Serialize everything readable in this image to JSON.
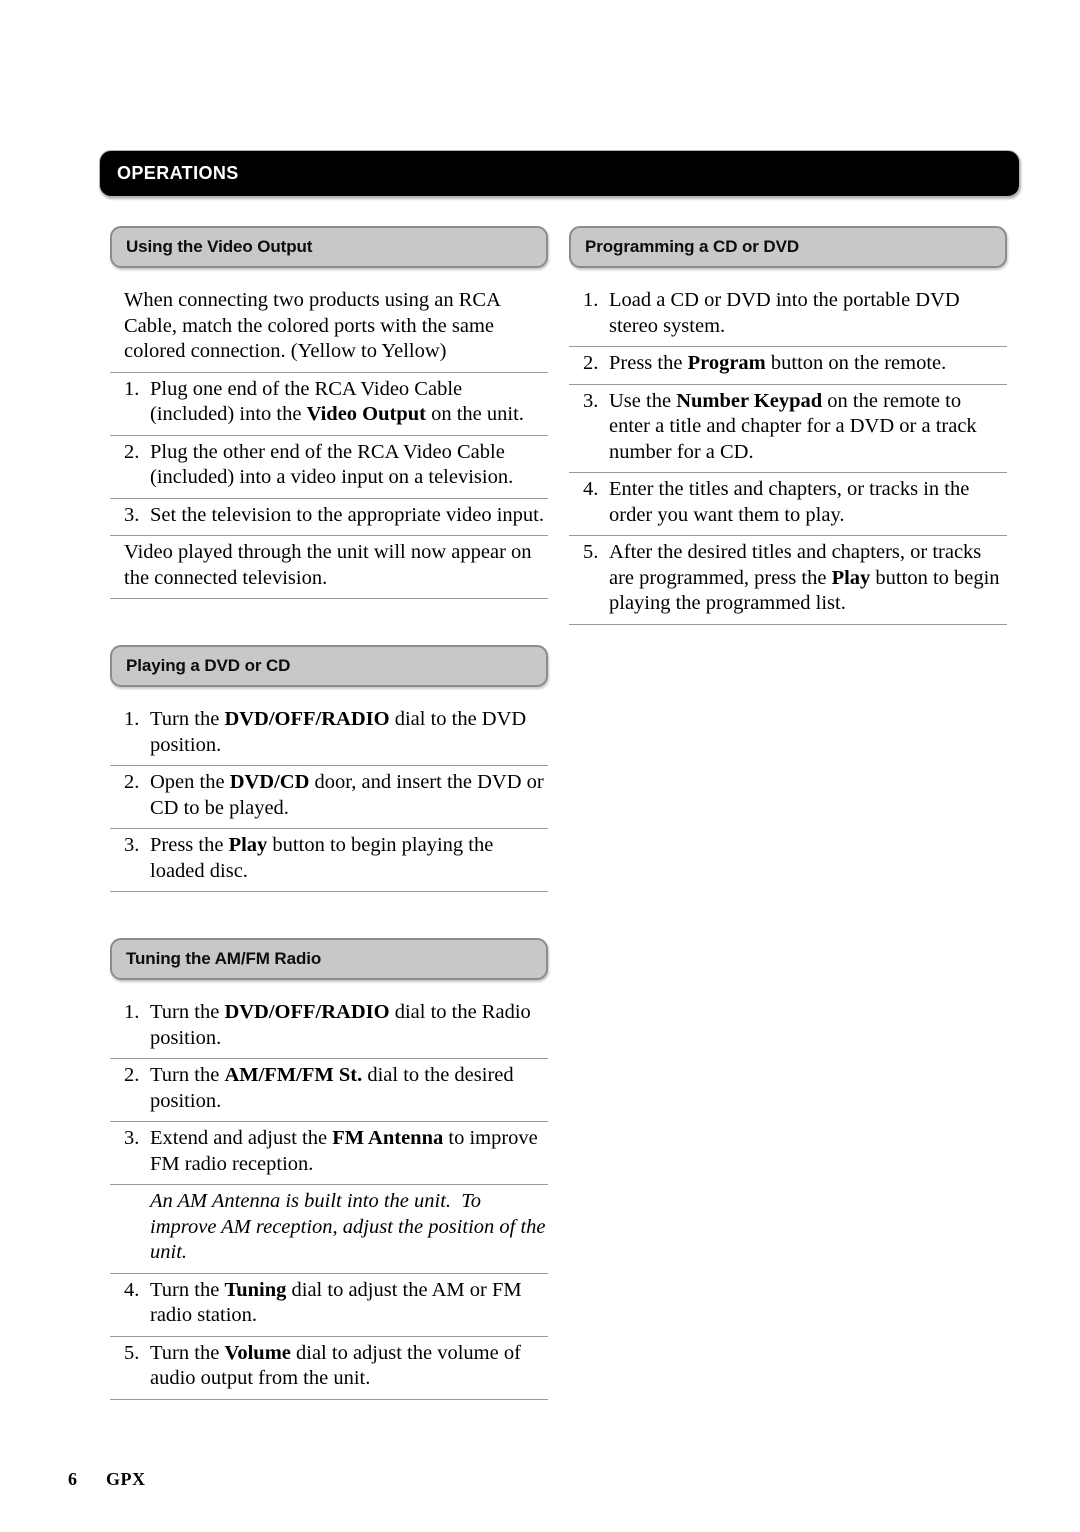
{
  "page": {
    "banner_title": "OPERATIONS",
    "background_color": "#ffffff",
    "banner_color": "#000000",
    "section_header_fill": "#c8c8c8",
    "section_header_border": "#8c8c8c",
    "rule_color": "#9a9a9a"
  },
  "footer": {
    "page_number": "6",
    "brand": "GPX"
  },
  "left_column": {
    "sections": [
      {
        "title": "Using the Video Output",
        "blocks": [
          {
            "kind": "paragraph",
            "html": "When connecting two products using an RCA Cable, match the colored ports with the same colored connection. (Yellow to Yellow)"
          },
          {
            "kind": "step",
            "num": "1.",
            "html": "Plug one end of the RCA Video Cable (included) into the <b>Video Output</b> on the unit."
          },
          {
            "kind": "step",
            "num": "2.",
            "html": "Plug the other end of the RCA Video Cable (included) into a video input on a television."
          },
          {
            "kind": "step",
            "num": "3.",
            "html": "Set the television to the appropriate video input."
          },
          {
            "kind": "paragraph",
            "html": "Video played through the unit will now appear on the connected television."
          }
        ]
      },
      {
        "title": "Playing a DVD or CD",
        "blocks": [
          {
            "kind": "step",
            "num": "1.",
            "html": "Turn the <b>DVD/OFF/RADIO</b> dial to the DVD position."
          },
          {
            "kind": "step",
            "num": "2.",
            "html": "Open the <b>DVD/CD</b> door, and insert the DVD or CD to be played."
          },
          {
            "kind": "step",
            "num": "3.",
            "html": "Press the <b>Play</b> button to begin playing the loaded disc."
          }
        ]
      },
      {
        "title": "Tuning the AM/FM Radio",
        "blocks": [
          {
            "kind": "step",
            "num": "1.",
            "html": "Turn the <b>DVD/OFF/RADIO</b> dial to the Radio position."
          },
          {
            "kind": "step",
            "num": "2.",
            "html": "Turn the <b>AM/FM/FM St.</b> dial to the desired position."
          },
          {
            "kind": "step",
            "num": "3.",
            "html": "Extend and adjust the <b>FM Antenna</b> to improve FM radio reception."
          },
          {
            "kind": "note",
            "html": "An AM Antenna is built into the unit.&nbsp; To improve AM reception, adjust the position of the unit."
          },
          {
            "kind": "step",
            "num": "4.",
            "html": "Turn the <b>Tuning</b> dial to adjust the AM or FM radio station."
          },
          {
            "kind": "step",
            "num": "5.",
            "html": "Turn the <b>Volume</b> dial to adjust the volume of audio output from the unit."
          }
        ]
      }
    ]
  },
  "right_column": {
    "sections": [
      {
        "title": "Programming a CD or DVD",
        "blocks": [
          {
            "kind": "step",
            "num": "1.",
            "html": "Load a CD or DVD into the portable DVD stereo system."
          },
          {
            "kind": "step",
            "num": "2.",
            "html": "Press the <b>Program</b> button on the remote."
          },
          {
            "kind": "step",
            "num": "3.",
            "html": "Use the <b>Number Keypad</b> on the remote to enter a title and chapter for a DVD or a track number for a CD."
          },
          {
            "kind": "step",
            "num": "4.",
            "html": "Enter the titles and chapters, or tracks in the order you want them to play."
          },
          {
            "kind": "step",
            "num": "5.",
            "html": "After the desired titles and chapters, or tracks are programmed, press the <b>Play</b> button to begin playing the programmed list."
          }
        ]
      }
    ]
  }
}
